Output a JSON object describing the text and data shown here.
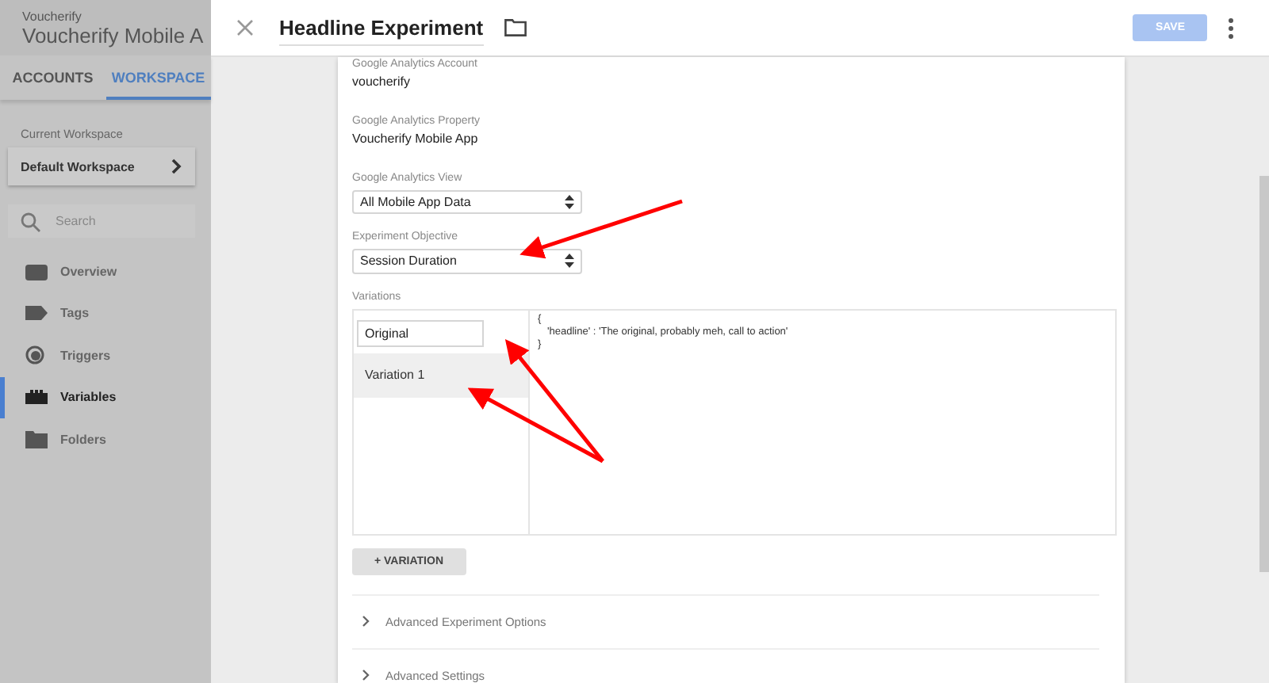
{
  "sidebar": {
    "account": "Voucherify",
    "container": "Voucherify Mobile A",
    "tabs": [
      {
        "label": "ACCOUNTS",
        "selected": false
      },
      {
        "label": "WORKSPACE",
        "selected": true
      }
    ],
    "workspace_label": "Current Workspace",
    "workspace": "Default Workspace",
    "search": {
      "placeholder": "Search"
    },
    "items": [
      {
        "label": "Overview",
        "kind": "overview",
        "selected": false
      },
      {
        "label": "Tags",
        "kind": "tags",
        "selected": false
      },
      {
        "label": "Triggers",
        "kind": "triggers",
        "selected": false
      },
      {
        "label": "Variables",
        "kind": "variables",
        "selected": true
      },
      {
        "label": "Folders",
        "kind": "folders",
        "selected": false
      }
    ]
  },
  "header": {
    "title": "Headline Experiment",
    "save": "SAVE",
    "save_disabled": true
  },
  "form": {
    "account_label": "Google Analytics Account",
    "account": "voucherify",
    "property_label": "Google Analytics Property",
    "property": "Voucherify Mobile App",
    "view_label": "Google Analytics View",
    "view": "All Mobile App Data",
    "objective_label": "Experiment Objective",
    "objective": "Session Duration",
    "variations_label": "Variations",
    "variations": [
      {
        "kind": "input",
        "name": "Original"
      },
      {
        "kind": "item",
        "name": "Variation 1"
      }
    ],
    "code": [
      "{",
      "'headline' : 'The original, probably meh, call to action'",
      "}"
    ],
    "add_button": "+ VARIATION",
    "sections": [
      {
        "label": "Advanced Experiment Options",
        "expanded": false
      },
      {
        "label": "Advanced Settings",
        "expanded": false
      }
    ]
  }
}
